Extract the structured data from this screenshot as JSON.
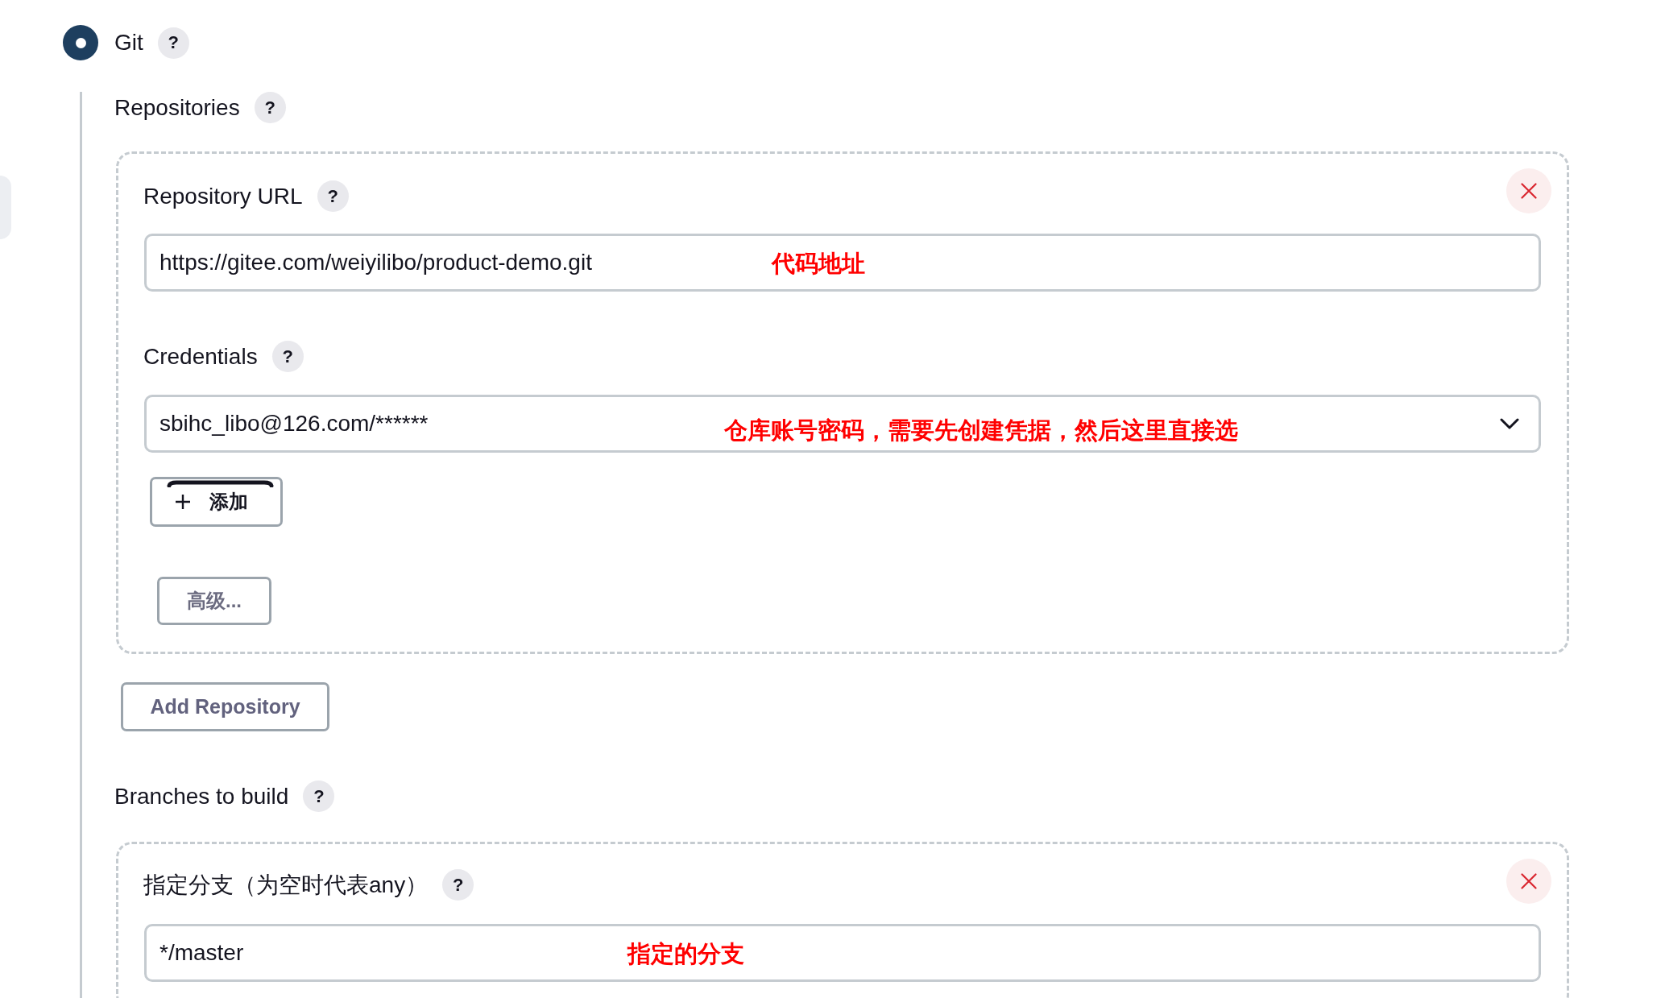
{
  "scm_option": {
    "label": "Git",
    "selected": true,
    "help": "?"
  },
  "repositories": {
    "label": "Repositories",
    "help": "?",
    "items": [
      {
        "url": {
          "label": "Repository URL",
          "help": "?",
          "value": "https://gitee.com/weiyilibo/product-demo.git",
          "annotation": "代码地址"
        },
        "credentials": {
          "label": "Credentials",
          "help": "?",
          "value": "sbihc_libo@126.com/******",
          "annotation": "仓库账号密码，需要先创建凭据，然后这里直接选"
        },
        "add_button": {
          "label": "添加"
        },
        "advanced_button": {
          "label": "高级..."
        }
      }
    ],
    "add_button": {
      "label": "Add Repository"
    }
  },
  "branches": {
    "label": "Branches to build",
    "help": "?",
    "items": [
      {
        "label": "指定分支（为空时代表any）",
        "help": "?",
        "value": "*/master",
        "annotation": "指定的分支"
      }
    ]
  }
}
